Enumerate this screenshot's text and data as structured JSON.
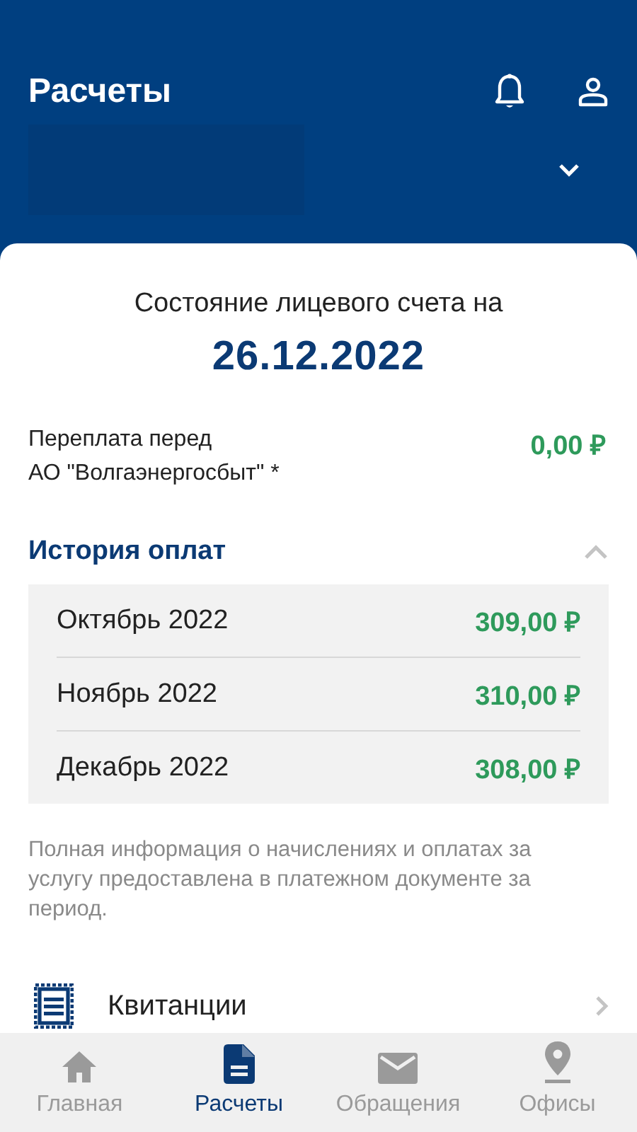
{
  "header": {
    "title": "Расчеты"
  },
  "summary": {
    "heading": "Состояние лицевого счета на",
    "date": "26.12.2022",
    "overpay_label": "Переплата перед\nАО \"Волгаэнергосбыт\" *",
    "overpay_amount": "0,00 ₽"
  },
  "history": {
    "title": "История оплат",
    "expanded": true,
    "rows": [
      {
        "month": "Октябрь 2022",
        "amount": "309,00 ₽"
      },
      {
        "month": "Ноябрь 2022",
        "amount": "310,00 ₽"
      },
      {
        "month": "Декабрь 2022",
        "amount": "308,00 ₽"
      }
    ]
  },
  "note": "Полная информация о начислениях и оплатах за услугу предоставлена в платежном документе за период.",
  "links": [
    {
      "label": "Квитанции"
    }
  ],
  "nav": [
    {
      "label": "Главная",
      "selected": false
    },
    {
      "label": "Расчеты",
      "selected": true
    },
    {
      "label": "Обращения",
      "selected": false
    },
    {
      "label": "Офисы",
      "selected": false
    }
  ]
}
